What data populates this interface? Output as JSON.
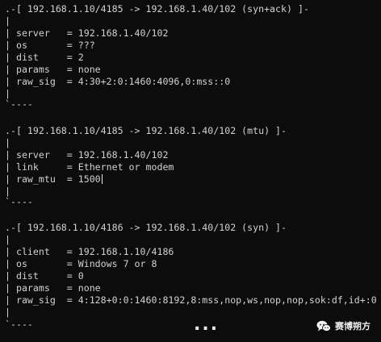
{
  "terminal": {
    "lines": [
      ".-[ 192.168.1.10/4185 -> 192.168.1.40/102 (syn+ack) ]-",
      "|",
      "| server   = 192.168.1.40/102",
      "| os       = ???",
      "| dist     = 2",
      "| params   = none",
      "| raw_sig  = 4:30+2:0:1460:4096,0:mss::0",
      "|",
      "`----",
      "",
      ".-[ 192.168.1.10/4185 -> 192.168.1.40/102 (mtu) ]-",
      "|",
      "| server   = 192.168.1.40/102",
      "| link     = Ethernet or modem",
      "| raw_mtu  = 1500",
      "|",
      "`----",
      "",
      ".-[ 192.168.1.10/4186 -> 192.168.1.40/102 (syn) ]-",
      "|",
      "| client   = 192.168.1.10/4186",
      "| os       = Windows 7 or 8",
      "| dist     = 0",
      "| params   = none",
      "| raw_sig  = 4:128+0:0:1460:8192,8:mss,nop,ws,nop,nop,sok:df,id+:0",
      "|",
      "`----"
    ]
  },
  "overlay": {
    "ellipsis": "...",
    "watermark_text": "赛博朔方"
  },
  "colors": {
    "background": "#0c0c0c",
    "text": "#d2d2d2"
  }
}
